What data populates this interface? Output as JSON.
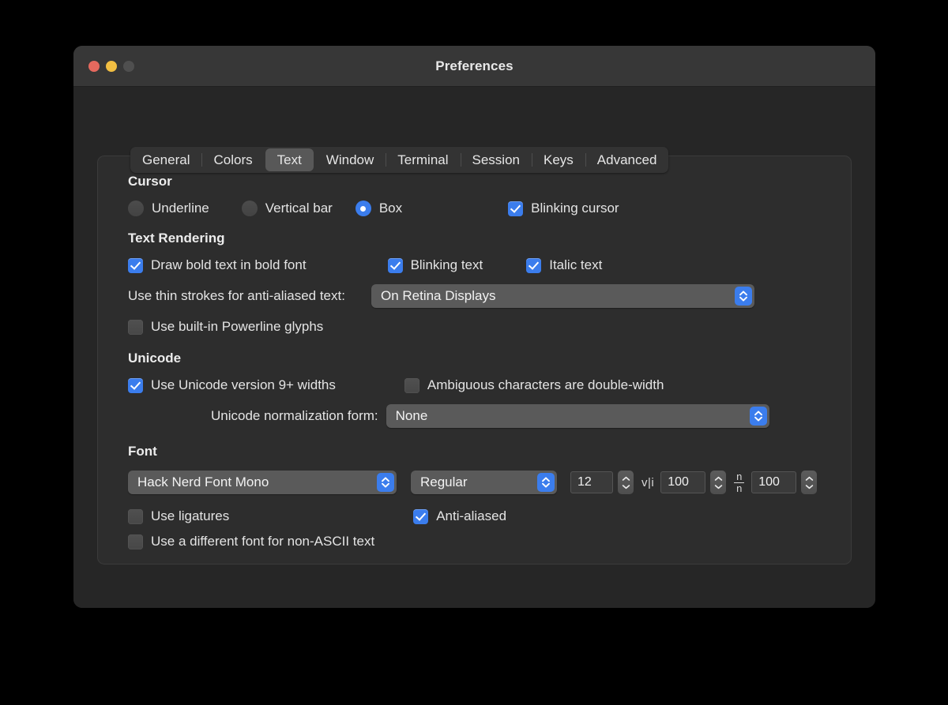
{
  "window": {
    "title": "Preferences",
    "traffic_lights": [
      {
        "name": "close",
        "color": "#e5695e"
      },
      {
        "name": "minimize",
        "color": "#f1be42"
      },
      {
        "name": "zoom",
        "color": "#4f4f4f"
      }
    ]
  },
  "tabs": [
    {
      "label": "General",
      "active": false
    },
    {
      "label": "Colors",
      "active": false
    },
    {
      "label": "Text",
      "active": true
    },
    {
      "label": "Window",
      "active": false
    },
    {
      "label": "Terminal",
      "active": false
    },
    {
      "label": "Session",
      "active": false
    },
    {
      "label": "Keys",
      "active": false
    },
    {
      "label": "Advanced",
      "active": false
    }
  ],
  "sections": {
    "cursor": {
      "title": "Cursor",
      "radios": [
        {
          "label": "Underline",
          "checked": false
        },
        {
          "label": "Vertical bar",
          "checked": false
        },
        {
          "label": "Box",
          "checked": true
        }
      ],
      "blinking_cursor": {
        "label": "Blinking cursor",
        "checked": true
      }
    },
    "text_rendering": {
      "title": "Text Rendering",
      "draw_bold": {
        "label": "Draw bold text in bold font",
        "checked": true
      },
      "blinking_text": {
        "label": "Blinking text",
        "checked": true
      },
      "italic_text": {
        "label": "Italic text",
        "checked": true
      },
      "thin_strokes_label": "Use thin strokes for anti-aliased text:",
      "thin_strokes_value": "On Retina Displays",
      "powerline": {
        "label": "Use built-in Powerline glyphs",
        "checked": false
      }
    },
    "unicode": {
      "title": "Unicode",
      "unicode9": {
        "label": "Use Unicode version 9+ widths",
        "checked": true
      },
      "ambiguous": {
        "label": "Ambiguous characters are double-width",
        "checked": false
      },
      "normalization_label": "Unicode normalization form:",
      "normalization_value": "None"
    },
    "font": {
      "title": "Font",
      "family_value": "Hack Nerd Font Mono",
      "style_value": "Regular",
      "size_value": "12",
      "horizontal_spacing_value": "100",
      "vertical_spacing_value": "100",
      "horizontal_spacing_glyph": "v|i",
      "vertical_spacing_glyph": "n/n",
      "ligatures": {
        "label": "Use ligatures",
        "checked": false
      },
      "antialiased": {
        "label": "Anti-aliased",
        "checked": true
      },
      "non_ascii": {
        "label": "Use a different font for non-ASCII text",
        "checked": false
      }
    }
  },
  "colors": {
    "accent": "#3b7ded",
    "window_bg": "#2b2b2b",
    "panel_bg": "#2d2d2d",
    "titlebar_bg": "#373737",
    "text": "#e4e4e4"
  }
}
